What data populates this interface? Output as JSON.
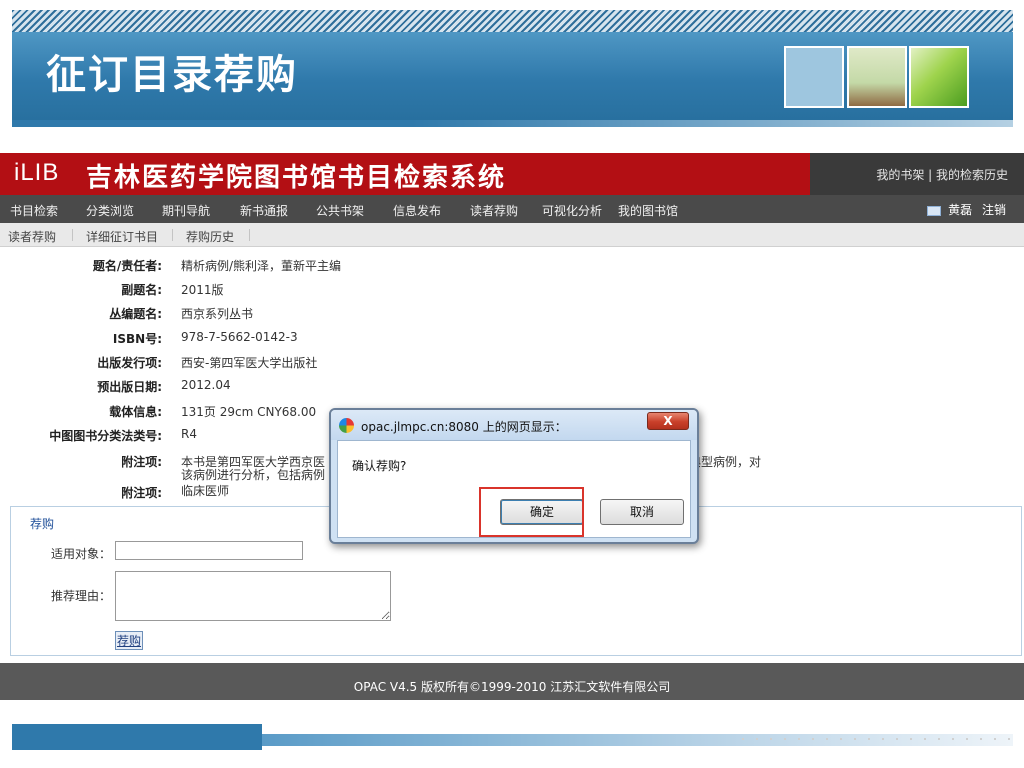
{
  "slide": {
    "title": "征订目录荐购"
  },
  "header": {
    "logo": "iLIB",
    "title": "吉林医药学院图书馆书目检索系统",
    "links": "我的书架 | 我的检索历史"
  },
  "nav": {
    "items": [
      "书目检索",
      "分类浏览",
      "期刊导航",
      "新书通报",
      "公共书架",
      "信息发布",
      "读者荐购",
      "可视化分析",
      "我的图书馆"
    ],
    "user": "黄磊",
    "logout": "注销"
  },
  "subnav": {
    "items": [
      "读者荐购",
      "详细征订书目",
      "荐购历史"
    ]
  },
  "details": [
    {
      "label": "题名/责任者:",
      "value": "精析病例/熊利泽，董新平主编"
    },
    {
      "label": "副题名:",
      "value": "2011版"
    },
    {
      "label": "丛编题名:",
      "value": "西京系列丛书"
    },
    {
      "label": "ISBN号:",
      "value": "978-7-5662-0142-3"
    },
    {
      "label": "出版发行项:",
      "value": "西安-第四军医大学出版社"
    },
    {
      "label": "预出版日期:",
      "value": "2012.04"
    },
    {
      "label": "载体信息:",
      "value": "131页 29cm CNY68.00"
    },
    {
      "label": "中图图书分类法类号:",
      "value": "R4"
    },
    {
      "label": "附注项:",
      "value": "本书是第四军医大学西京医",
      "value_tail": "典型病例，对",
      "value_line2": "该病例进行分析，包括病例"
    },
    {
      "label": "附注项:",
      "value": "临床医师"
    }
  ],
  "recommend": {
    "title": "荐购",
    "target_label": "适用对象：",
    "target_value": "",
    "reason_label": "推荐理由：",
    "reason_value": "",
    "submit": "荐购"
  },
  "footer": {
    "text": "OPAC V4.5   版权所有©1999-2010 江苏汇文软件有限公司"
  },
  "dialog": {
    "title": "opac.jlmpc.cn:8080 上的网页显示：",
    "close": "X",
    "message": "确认荐购?",
    "ok": "确定",
    "cancel": "取消"
  }
}
